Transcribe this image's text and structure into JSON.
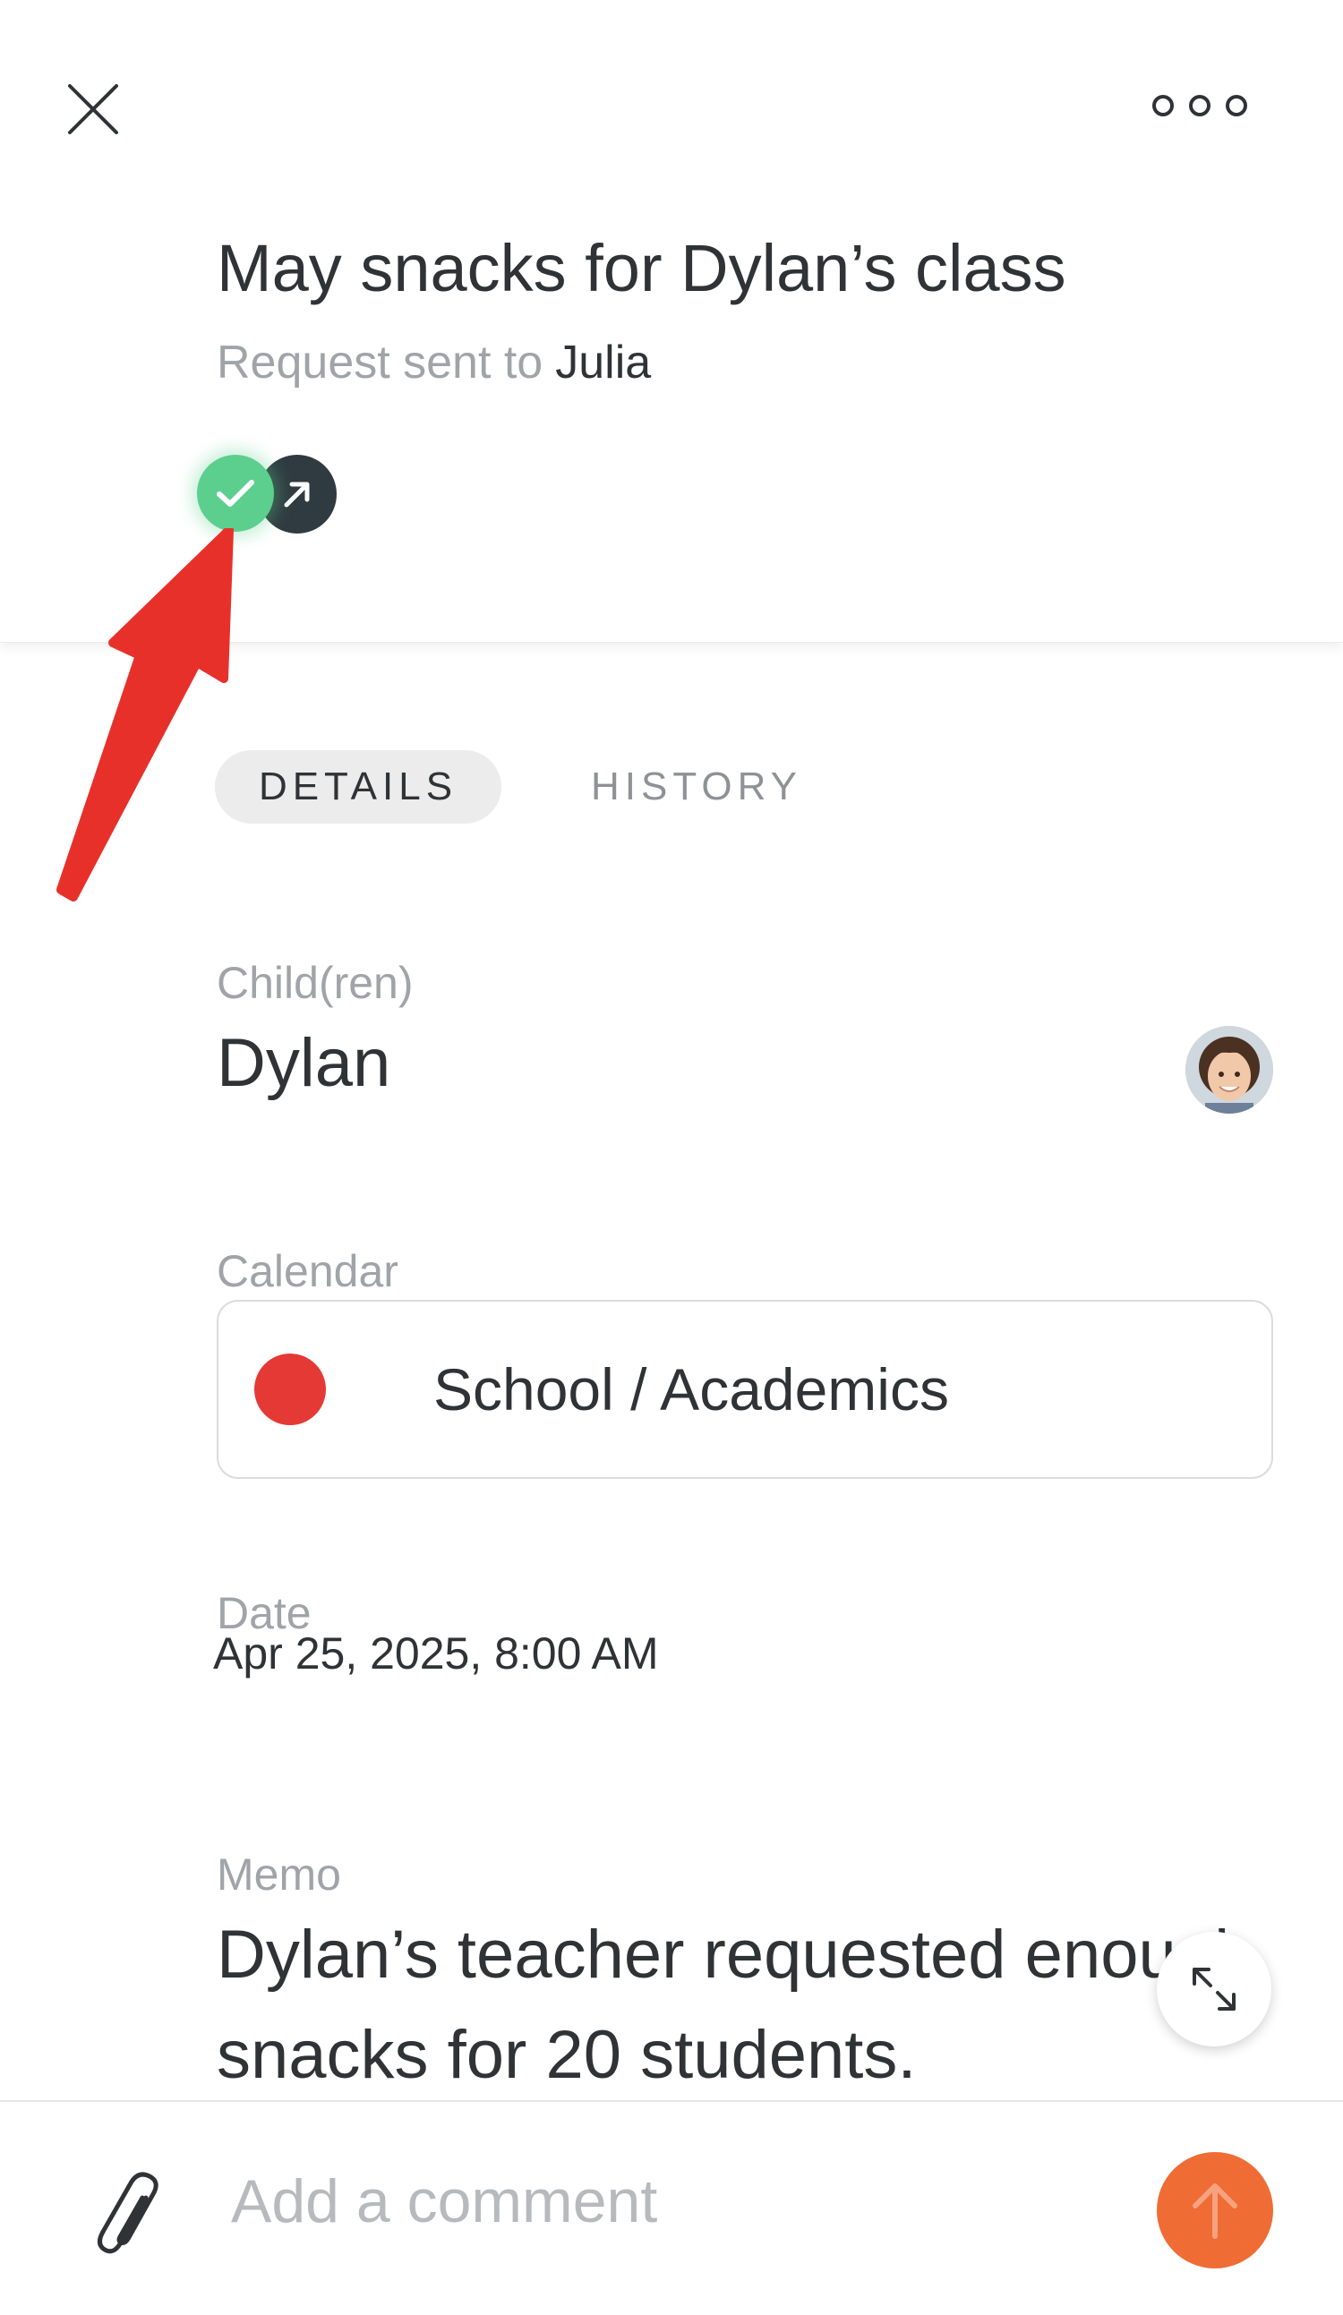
{
  "header": {
    "title": "May snacks for Dylan’s class",
    "subtitle_prefix": "Request sent to",
    "recipient": "Julia",
    "status_icons": [
      "check-icon",
      "arrow-up-right-icon"
    ]
  },
  "tabs": [
    {
      "label": "DETAILS",
      "active": true
    },
    {
      "label": "HISTORY",
      "active": false
    }
  ],
  "fields": {
    "children_label": "Child(ren)",
    "child_name": "Dylan",
    "calendar_label": "Calendar",
    "calendar_value": "School / Academics",
    "calendar_color": "#e53935",
    "date_label": "Date",
    "date_value": "Apr 25, 2025, 8:00 AM",
    "memo_label": "Memo",
    "memo_text": "Dylan’s teacher requested enough snacks for 20 students."
  },
  "comment": {
    "placeholder": "Add a comment"
  },
  "colors": {
    "complete_green": "#5ccf8e",
    "sent_dark": "#2f3b40",
    "send_orange": "#ef6c35",
    "annotation_red": "#e8302a"
  }
}
